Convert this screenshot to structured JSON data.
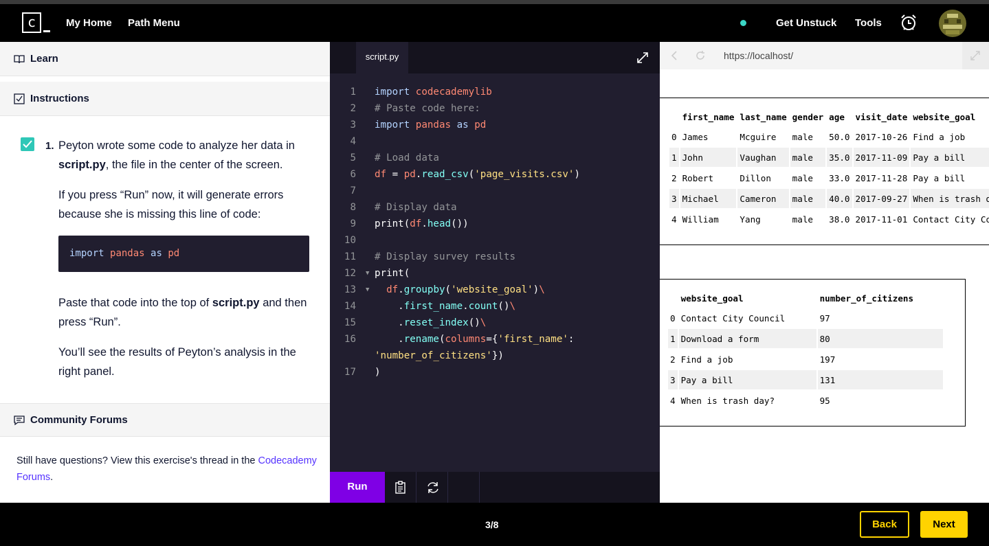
{
  "nav": {
    "logo_letter": "c",
    "my_home": "My Home",
    "path_menu": "Path Menu",
    "get_unstuck": "Get Unstuck",
    "tools": "Tools"
  },
  "learn_panel": {
    "learn_label": "Learn",
    "instructions_label": "Instructions",
    "step_number": "1.",
    "p1_pre": "Peyton wrote some code to analyze her data in ",
    "p1_bold": "script.py",
    "p1_post": ", the file in the center of the screen.",
    "p2": "If you press “Run” now, it will generate errors because she is missing this line of code:",
    "snippet": {
      "kw1": "import",
      "mod": "pandas",
      "kw2": "as",
      "alias": "pd"
    },
    "p3_pre": "Paste that code into the top of ",
    "p3_bold": "script.py",
    "p3_post": " and then press “Run”.",
    "p4": "You’ll see the results of Peyton’s analysis in the right panel.",
    "forums_label": "Community Forums",
    "forums_text": "Still have questions? View this exercise's thread in the ",
    "forums_link": "Codecademy Forums",
    "forums_end": "."
  },
  "editor": {
    "tab": "script.py",
    "line_numbers": [
      "1",
      "2",
      "3",
      "4",
      "5",
      "6",
      "7",
      "8",
      "9",
      "10",
      "11",
      "12",
      "13",
      "14",
      "15",
      "16",
      "",
      "17"
    ],
    "run_label": "Run"
  },
  "browser": {
    "url": "https://localhost/",
    "table1": {
      "headers": [
        "",
        "first_name",
        "last_name",
        "gender",
        "age",
        "visit_date",
        "website_goal"
      ],
      "rows": [
        [
          "0",
          "James",
          "Mcguire",
          "male",
          "50.0",
          "2017-10-26",
          "Find a job"
        ],
        [
          "1",
          "John",
          "Vaughan",
          "male",
          "35.0",
          "2017-11-09",
          "Pay a bill"
        ],
        [
          "2",
          "Robert",
          "Dillon",
          "male",
          "33.0",
          "2017-11-28",
          "Pay a bill"
        ],
        [
          "3",
          "Michael",
          "Cameron",
          "male",
          "40.0",
          "2017-09-27",
          "When is trash day?"
        ],
        [
          "4",
          "William",
          "Yang",
          "male",
          "38.0",
          "2017-11-01",
          "Contact City Council"
        ]
      ]
    },
    "table2": {
      "headers": [
        "",
        "website_goal",
        "number_of_citizens"
      ],
      "rows": [
        [
          "0",
          "Contact City Council",
          "97"
        ],
        [
          "1",
          "Download a form",
          "80"
        ],
        [
          "2",
          "Find a job",
          "197"
        ],
        [
          "3",
          "Pay a bill",
          "131"
        ],
        [
          "4",
          "When is trash day?",
          "95"
        ]
      ]
    }
  },
  "footer": {
    "progress": "3/8",
    "back": "Back",
    "next": "Next"
  }
}
